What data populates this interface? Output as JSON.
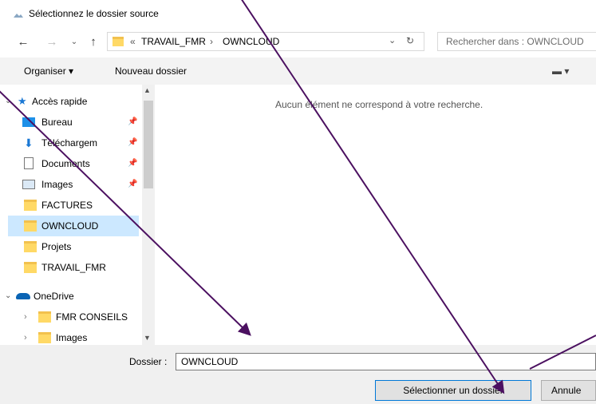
{
  "window": {
    "title": "Sélectionnez le dossier source"
  },
  "address": {
    "breadcrumb_overflow": "«",
    "crumbs": [
      "TRAVAIL_FMR",
      "OWNCLOUD"
    ],
    "separator": "›",
    "search_placeholder": "Rechercher dans : OWNCLOUD"
  },
  "toolbar": {
    "organize": "Organiser ▾",
    "new_folder": "Nouveau dossier",
    "view": "▬ ▾"
  },
  "nav": {
    "quick_access": "Accès rapide",
    "items": [
      {
        "label": "Bureau",
        "icon": "desktop-icon",
        "pinned": true
      },
      {
        "label": "Téléchargem",
        "icon": "downloads-icon",
        "pinned": true
      },
      {
        "label": "Documents",
        "icon": "documents-icon",
        "pinned": true
      },
      {
        "label": "Images",
        "icon": "pictures-icon",
        "pinned": true
      },
      {
        "label": "FACTURES",
        "icon": "folder-icon",
        "pinned": false
      },
      {
        "label": "OWNCLOUD",
        "icon": "folder-icon",
        "pinned": false,
        "selected": true
      },
      {
        "label": "Projets",
        "icon": "folder-icon",
        "pinned": false
      },
      {
        "label": "TRAVAIL_FMR",
        "icon": "folder-icon",
        "pinned": false
      }
    ],
    "onedrive": "OneDrive",
    "onedrive_items": [
      {
        "label": "FMR CONSEILS",
        "icon": "folder-icon"
      },
      {
        "label": "Images",
        "icon": "folder-icon"
      }
    ]
  },
  "main": {
    "empty_message": "Aucun élément ne correspond à votre recherche."
  },
  "footer": {
    "folder_label": "Dossier :",
    "folder_value": "OWNCLOUD",
    "select_button": "Sélectionner un dossier",
    "cancel_button": "Annule"
  },
  "colors": {
    "annotation_arrow": "#4b1060",
    "selection": "#cce8ff",
    "accent": "#0078d7"
  }
}
